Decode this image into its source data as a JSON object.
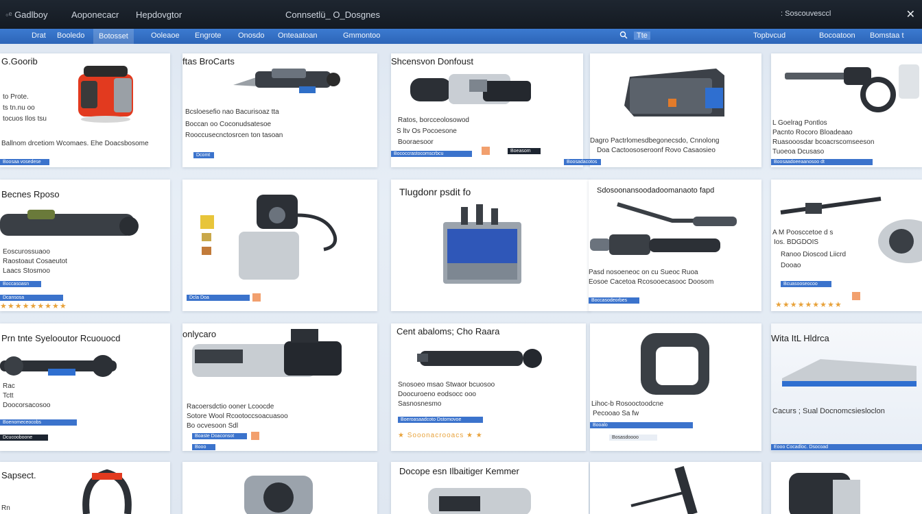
{
  "titlebar": {
    "items": [
      "Gadlboy",
      "Aoponecacr",
      "Hepdovgtor",
      "Connsetlü_ O_Dosgnes",
      ": Soscouvesccl"
    ],
    "close": "✕"
  },
  "navbar": {
    "items": [
      "Drat",
      "Booledo",
      "Botosset",
      "Ooleaoe",
      "Engrote",
      "Onosdo",
      "Onteaatoan",
      "Gmmontoo",
      "Topbvcud",
      "Bocoatoon",
      "Bomstaa t"
    ],
    "search_label": "Tte"
  },
  "cards": [
    {
      "title": "G.Goorib",
      "lines": [
        "to Prote.",
        "ts tn.nu oo",
        "tocuos Ilos tsu",
        "Ballnom drcetiom Wcomaes. Ehe Doacsbosome"
      ],
      "bar": "Boosaa vosedese"
    },
    {
      "title": "ftas BroCarts",
      "lines": [
        "Bcsloesefio nao Bacurisoaz tta",
        "Boccan oo Coconudsatesoe",
        "Rooccusecnctosrcen ton tasoan"
      ],
      "bar": "Dcomt"
    },
    {
      "title": "Shcensvon Donfoust",
      "lines": [
        "Ratos, borcceolosowod",
        "S ltv Os Pocoesone",
        "Booraesoor"
      ],
      "bar": "Bococcrastocomscrbcu",
      "bar2": "Boeasom"
    },
    {
      "title": "",
      "lines": [
        "Dagro Pactrlomesdbegonecsdo, Cnnolong",
        "Doa Cactoososeroonf Rovo Casaosieo"
      ],
      "bar": "Boosadacotos"
    },
    {
      "title": "",
      "lines": [
        "L Goelrag Pontlos",
        "Pacnto Rocoro Bloadeaao",
        "Ruasooosdar bcoacrscomseeson",
        "Tuoeoa Dcusaso"
      ],
      "bar": "Boosaadoeeaanosoo dt"
    },
    {
      "title": "Becnes Rposo",
      "lines": [
        "Eoscurossuaoo",
        "Raostoaut Cosaeutot",
        "Laacs Stosmoo"
      ],
      "bar": "Boccasoasn",
      "bar2": "Dcansosa",
      "stars": "★★★★★★★★★"
    },
    {
      "title": "",
      "lines": [],
      "bar": "Dcla Doa"
    },
    {
      "title": "Tlugdonr psdit fo",
      "lines": [],
      "bar": ""
    },
    {
      "title": "Sdosoonansoodadoomanaoto fapd",
      "lines": [
        "Pasd nosoeneoc on cu Sueoc Ruoa",
        "Eosoe Cacetoa Rcosooecasooc Doosom"
      ],
      "bar": "Boccasodeorbes"
    },
    {
      "title": "",
      "lines": [
        "A M Poosccetoe d s",
        "Ios. BDGDOIS",
        "Ranoo Dioscod Liicrd",
        "Dooao"
      ],
      "bar": "Bcuasooseocoo",
      "stars": "★★★★★★★★★"
    },
    {
      "title": "Prn tnte Syelooutor Rcuouocd",
      "lines": [
        "Rac",
        "Tctt",
        "Doocorsacosoo"
      ],
      "bar": "Boenomeceocobs",
      "bar2": "Dcucooboone"
    },
    {
      "title": "onlycaro",
      "lines": [
        "Racoersdctio ooner Lcoocde",
        "Sotore Wool Rcootoccsoacuasoo",
        "Bo ocvesoon Sdl"
      ],
      "bar": "Boaste Doaconsot",
      "bar2": "Booo"
    },
    {
      "title": "Cent abaloms; Cho Raara",
      "lines": [
        "Snosoeo msao Stwaor bcuosoo",
        "Doocuroeno eodsocc ooo",
        "Sasnosnesmo"
      ],
      "bar": "Boeroasaadcoto Dstomovoe",
      "stars": "★ Sooonacrooacs ★ ★"
    },
    {
      "title": "",
      "lines": [
        "Lihoc-b Rosooctoodcne",
        "Pecooao Sa fw"
      ],
      "bar": "Booalo",
      "bar2": "Bosasdoooo"
    },
    {
      "title": "Wita ItL Hldrca",
      "lines": [
        "Cacurs ; Sual Docnomcsiesloclon"
      ],
      "bar": "Eooo Cocadloc. Dsocoad"
    },
    {
      "title": "Sapsect.",
      "lines": [
        "Rn"
      ],
      "bar": ""
    },
    {
      "title": "",
      "lines": [],
      "bar": ""
    },
    {
      "title": "Docope esn Ilbaitiger Kemmer",
      "lines": [],
      "bar": ""
    },
    {
      "title": "",
      "lines": [],
      "bar": ""
    },
    {
      "title": "",
      "lines": [],
      "bar": ""
    }
  ],
  "colors": {
    "accent": "#3b73cc",
    "orange": "#f2a06e",
    "star": "#e8a23a",
    "titlebar": "#141a22"
  }
}
